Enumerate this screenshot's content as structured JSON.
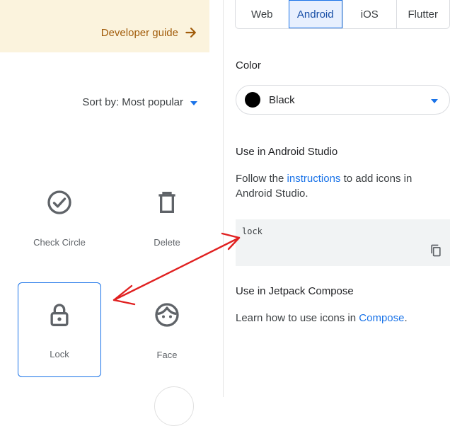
{
  "left_panel": {
    "developer_guide": "Developer guide",
    "sort_label": "Sort by: Most popular",
    "icons": [
      {
        "name": "Check Circle",
        "icon": "check-circle-icon"
      },
      {
        "name": "Delete",
        "icon": "delete-icon"
      },
      {
        "name": "Lock",
        "icon": "lock-icon",
        "selected": true
      },
      {
        "name": "Face",
        "icon": "face-icon"
      }
    ]
  },
  "right_panel": {
    "tabs": [
      "Web",
      "Android",
      "iOS",
      "Flutter"
    ],
    "active_tab": "Android",
    "color_label": "Color",
    "color_value": "Black",
    "android_studio_title": "Use in Android Studio",
    "android_studio_text_before": "Follow the ",
    "android_studio_link": "instructions",
    "android_studio_text_after": " to add icons in Android Studio.",
    "code": "lock",
    "compose_title": "Use in Jetpack Compose",
    "compose_text_before": "Learn how to use icons in ",
    "compose_link": "Compose",
    "compose_text_after": "."
  },
  "colors": {
    "accent": "#1a73e8",
    "banner_bg": "#fbf3dd",
    "banner_text": "#a15c0b",
    "annotation": "#e02020"
  }
}
